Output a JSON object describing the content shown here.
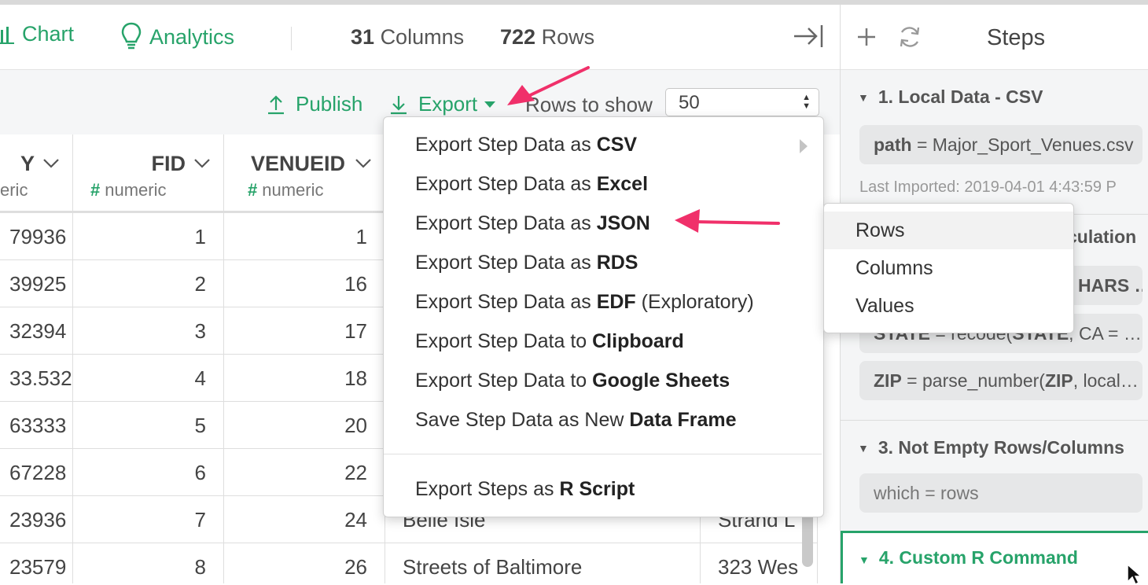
{
  "header": {
    "chart_label": "Chart",
    "analytics_label": "Analytics",
    "columns_count": "31",
    "columns_label": "Columns",
    "rows_count": "722",
    "rows_label": "Rows"
  },
  "toolbar": {
    "publish_label": "Publish",
    "export_label": "Export",
    "rows_to_show_label": "Rows to show",
    "rows_to_show_value": "50"
  },
  "table": {
    "columns": [
      {
        "name": "Y",
        "type_symbol": "",
        "type": "eric"
      },
      {
        "name": "FID",
        "type_symbol": "#",
        "type": "numeric"
      },
      {
        "name": "VENUEID",
        "type_symbol": "#",
        "type": "numeric"
      }
    ],
    "rows": [
      {
        "y": "79936",
        "fid": "1",
        "venueid": "1",
        "name": "",
        "address": ""
      },
      {
        "y": "39925",
        "fid": "2",
        "venueid": "16",
        "name": "",
        "address": ""
      },
      {
        "y": "32394",
        "fid": "3",
        "venueid": "17",
        "name": "",
        "address": ""
      },
      {
        "y": "33.532",
        "fid": "4",
        "venueid": "18",
        "name": "",
        "address": ""
      },
      {
        "y": "63333",
        "fid": "5",
        "venueid": "20",
        "name": "",
        "address": ""
      },
      {
        "y": "67228",
        "fid": "6",
        "venueid": "22",
        "name": "",
        "address": ""
      },
      {
        "y": "23936",
        "fid": "7",
        "venueid": "24",
        "name": "Belle Isle",
        "address": "Strand L"
      },
      {
        "y": "23579",
        "fid": "8",
        "venueid": "26",
        "name": "Streets of Baltimore",
        "address": "323 Wes"
      }
    ]
  },
  "export_menu": {
    "items": [
      {
        "prefix": "Export Step Data as ",
        "bold": "CSV",
        "suffix": ""
      },
      {
        "prefix": "Export Step Data as ",
        "bold": "Excel",
        "suffix": ""
      },
      {
        "prefix": "Export Step Data as ",
        "bold": "JSON",
        "suffix": ""
      },
      {
        "prefix": "Export Step Data as ",
        "bold": "RDS",
        "suffix": ""
      },
      {
        "prefix": "Export Step Data as ",
        "bold": "EDF",
        "suffix": " (Exploratory)"
      },
      {
        "prefix": "Export Step Data to ",
        "bold": "Clipboard",
        "suffix": ""
      },
      {
        "prefix": "Export Step Data to ",
        "bold": "Google Sheets",
        "suffix": ""
      },
      {
        "prefix": "Save Step Data as New ",
        "bold": "Data Frame",
        "suffix": ""
      },
      {
        "prefix": "Export Steps as ",
        "bold": "R Script",
        "suffix": ""
      }
    ]
  },
  "json_submenu": {
    "items": [
      "Rows",
      "Columns",
      "Values"
    ]
  },
  "steps_panel": {
    "title": "Steps",
    "step1": {
      "title": "1. Local Data - CSV",
      "path_key": "path",
      "path_value": " = Major_Sport_Venues.csv",
      "last_imported": "Last Imported: 2019-04-01 4:43:59 P"
    },
    "step2": {
      "title_partial": "culation",
      "line1_partial": "HARS …",
      "line2_key": "STATE",
      "line2_mid": " = recode(",
      "line2_key2": "STATE",
      "line2_rest": ", CA = …",
      "line3_key": "ZIP",
      "line3_mid": " = parse_number(",
      "line3_key2": "ZIP",
      "line3_rest": ", local…"
    },
    "step3": {
      "title": "3. Not Empty Rows/Columns",
      "value": "which = rows"
    },
    "step4": {
      "title": "4. Custom R Command"
    }
  },
  "colors": {
    "accent": "#27a36a",
    "annotation_arrow": "#f0306a"
  }
}
